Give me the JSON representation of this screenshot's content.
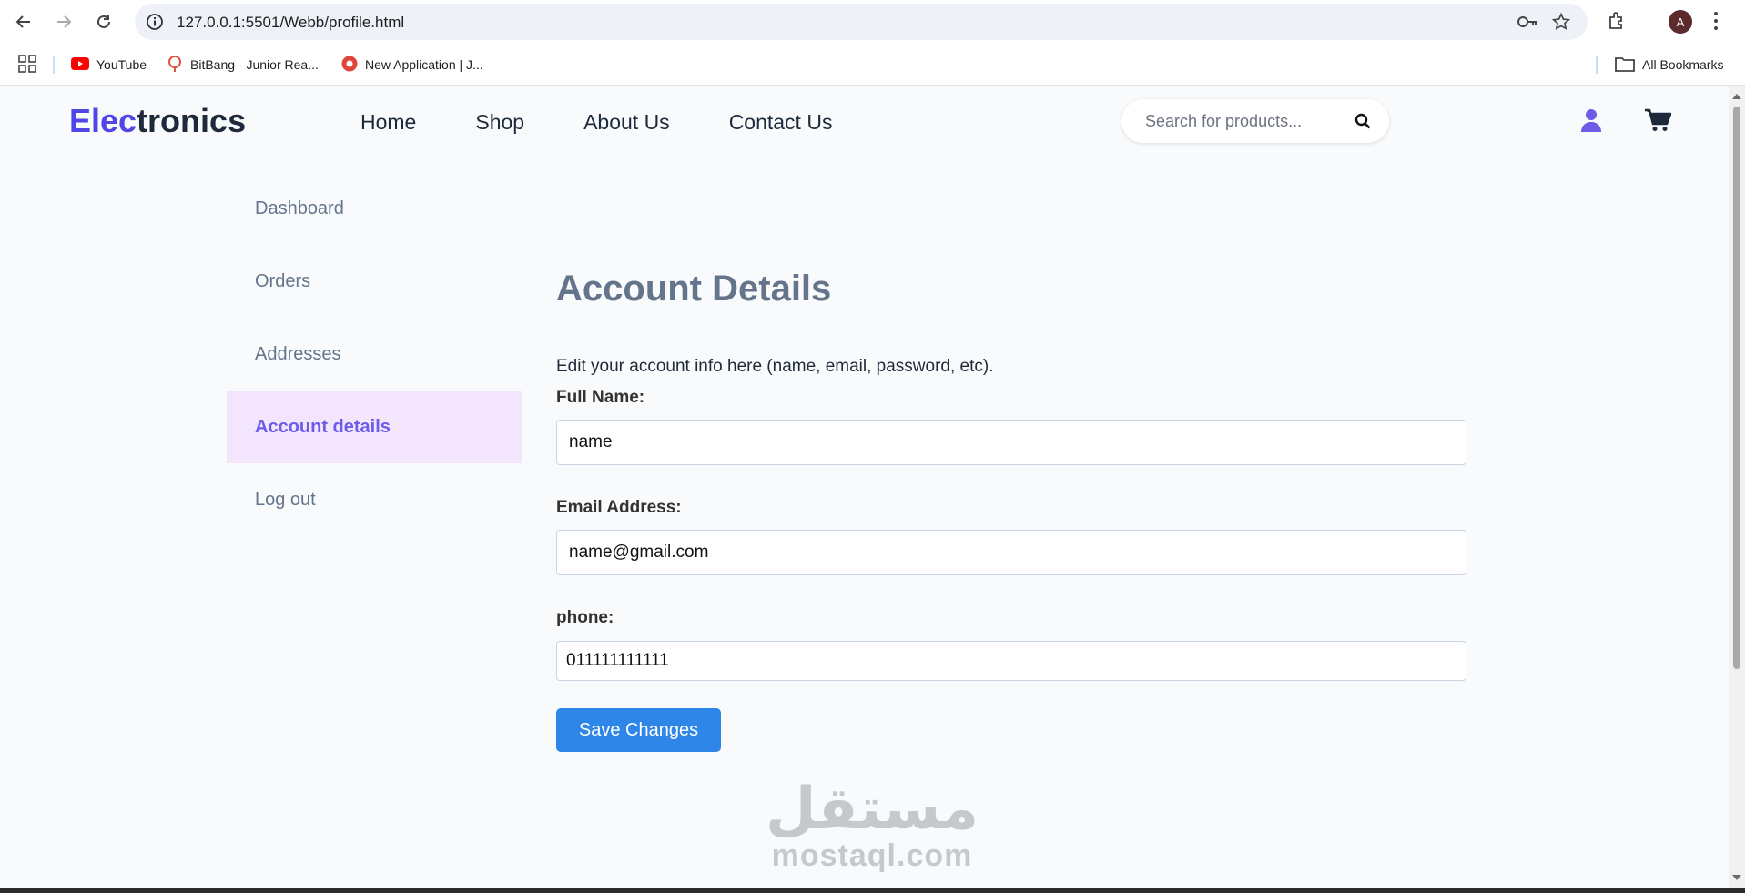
{
  "browser": {
    "url": "127.0.0.1:5501/Webb/profile.html",
    "profile_initial": "A",
    "bookmarks": [
      {
        "label": "YouTube",
        "icon": "youtube-icon"
      },
      {
        "label": "BitBang - Junior Rea...",
        "icon": "bitbang-icon"
      },
      {
        "label": "New Application | J...",
        "icon": "record-icon"
      }
    ],
    "all_bookmarks": "All Bookmarks"
  },
  "header": {
    "logo_accent": "Elec",
    "logo_rest": "tronics",
    "nav": [
      "Home",
      "Shop",
      "About Us",
      "Contact Us"
    ],
    "search_placeholder": "Search for products..."
  },
  "sidebar": {
    "items": [
      {
        "label": "Dashboard",
        "active": false
      },
      {
        "label": "Orders",
        "active": false
      },
      {
        "label": "Addresses",
        "active": false
      },
      {
        "label": "Account details",
        "active": true
      },
      {
        "label": "Log out",
        "active": false
      }
    ]
  },
  "account": {
    "title": "Account Details",
    "description": "Edit your account info here (name, email, password, etc).",
    "fields": [
      {
        "label": "Full Name:",
        "value": "name"
      },
      {
        "label": "Email Address:",
        "value": "name@gmail.com"
      },
      {
        "label": "phone:",
        "value": "011111111111"
      }
    ],
    "save_label": "Save Changes"
  },
  "watermark": {
    "arabic": "مستقل",
    "latin": "mostaql.com"
  },
  "colors": {
    "logo_accent": "#4f46e5",
    "active_sidebar_bg": "#f3e6fc",
    "active_sidebar_text": "#6c5ce7",
    "save_button": "#2e86e8"
  }
}
